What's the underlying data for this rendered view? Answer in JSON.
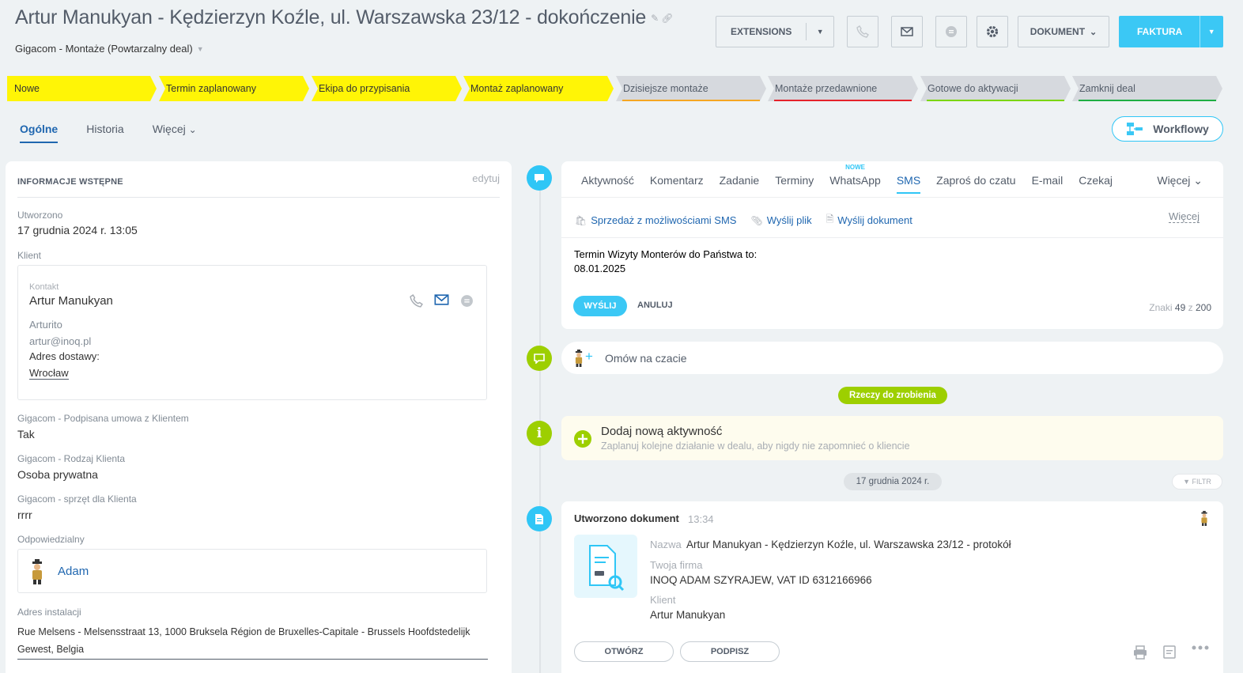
{
  "header": {
    "title": "Artur Manukyan - Kędzierzyn Koźle, ul. Warszawska 23/12 - dokończenie",
    "subtitle": "Gigacom - Montaże (Powtarzalny deal)",
    "buttons": {
      "extensions": "EXTENSIONS",
      "dokument": "DOKUMENT",
      "faktura": "FAKTURA"
    }
  },
  "stages": [
    {
      "label": "Nowe",
      "state": "done"
    },
    {
      "label": "Termin zaplanowany",
      "state": "done"
    },
    {
      "label": "Ekipa do przypisania",
      "state": "done"
    },
    {
      "label": "Montaż zaplanowany",
      "state": "done"
    },
    {
      "label": "Dzisiejsze montaże",
      "state": "todo",
      "color": "#f5a623"
    },
    {
      "label": "Montaże przedawnione",
      "state": "todo",
      "color": "#e5222b"
    },
    {
      "label": "Gotowe do aktywacji",
      "state": "todo",
      "color": "#7bd500"
    },
    {
      "label": "Zamknij deal",
      "state": "todo",
      "color": "#1eae43"
    }
  ],
  "tabs": [
    "Ogólne",
    "Historia",
    "Więcej"
  ],
  "workflow_label": "Workflowy",
  "info": {
    "heading": "INFORMACJE WSTĘPNE",
    "edit": "edytuj",
    "created_label": "Utworzono",
    "created_value": "17 grudnia 2024 r. 13:05",
    "client_label": "Klient",
    "contact_label": "Kontakt",
    "contact_name": "Artur Manukyan",
    "contact_nick": "Arturito",
    "contact_email": "artur@inoq.pl",
    "delivery_label": "Adres dostawy:",
    "delivery_city": "Wrocław",
    "f1_label": "Gigacom - Podpisana umowa z Klientem",
    "f1_value": "Tak",
    "f2_label": "Gigacom - Rodzaj Klienta",
    "f2_value": "Osoba prywatna",
    "f3_label": "Gigacom - sprzęt dla Klienta",
    "f3_value": "rrrr",
    "resp_label": "Odpowiedzialny",
    "resp_name": "Adam",
    "addr_label": "Adres instalacji",
    "addr_value": "Rue Melsens - Melsensstraat 13, 1000 Bruksela Région de Bruxelles-Capitale - Brussels Hoofdstedelijk Gewest, Belgia"
  },
  "editor": {
    "tabs": [
      "Aktywność",
      "Komentarz",
      "Zadanie",
      "Terminy",
      "WhatsApp",
      "SMS",
      "Zaproś do czatu",
      "E-mail",
      "Czekaj"
    ],
    "new_badge": "NOWE",
    "more": "Więcej",
    "actions": [
      "Sprzedaż z możliwościami SMS",
      "Wyślij plik",
      "Wyślij dokument"
    ],
    "actions_more": "Więcej",
    "text_line1": "Termin Wizyty Monterów do Państwa to:",
    "text_line2": "08.01.2025",
    "send": "WYŚLIJ",
    "cancel": "ANULUJ",
    "chars_label": "Znaki",
    "chars_used": "49",
    "chars_of": "z",
    "chars_max": "200"
  },
  "chat": {
    "label": "Omów na czacie"
  },
  "todo_pill": "Rzeczy do zrobienia",
  "add_activity": {
    "title": "Dodaj nową aktywność",
    "subtitle": "Zaplanuj kolejne działanie w dealu, aby nigdy nie zapomnieć o kliencie"
  },
  "date_pill": "17 grudnia 2024 r.",
  "filter": "FILTR",
  "doc": {
    "title": "Utworzono dokument",
    "time": "13:34",
    "name_label": "Nazwa",
    "name_value": "Artur Manukyan - Kędzierzyn Koźle, ul. Warszawska 23/12 - protokół",
    "company_label": "Twoja firma",
    "company_value": "INOQ ADAM SZYRAJEW, VAT ID 6312166966",
    "client_label": "Klient",
    "client_value": "Artur Manukyan",
    "open": "OTWÓRZ",
    "sign": "PODPISZ"
  },
  "colors": {
    "accent": "#3bc8f5",
    "link": "#2067b0",
    "stage_done": "#fff506",
    "green": "#9dcf00"
  }
}
